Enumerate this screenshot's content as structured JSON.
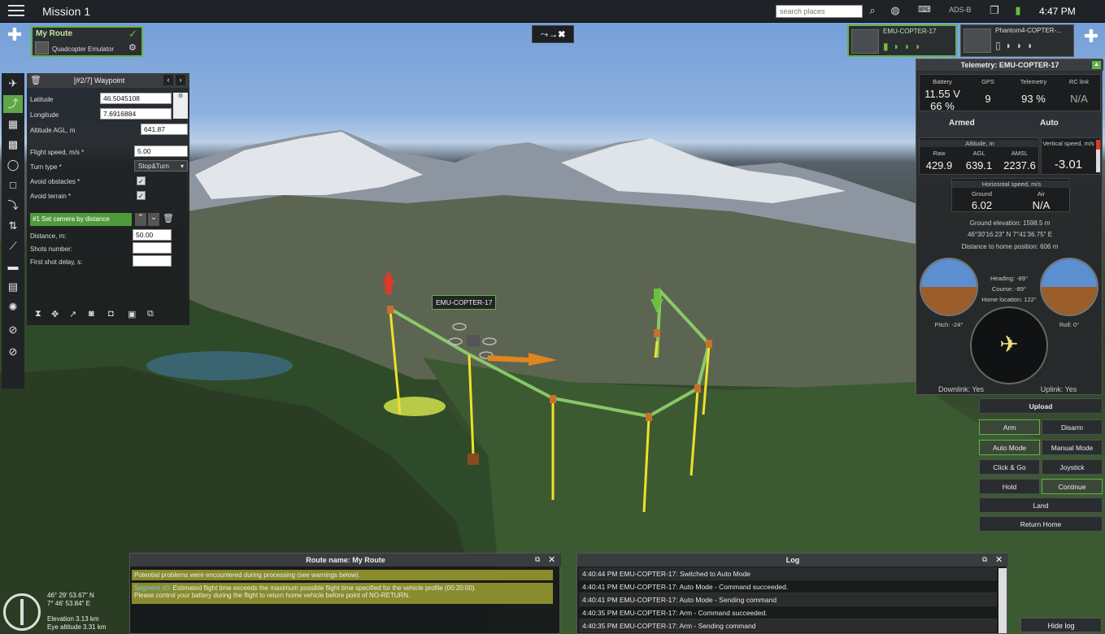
{
  "app": {
    "mission_title": "Mission 1",
    "search_placeholder": "search places",
    "adsb_label": "ADS-B",
    "clock": "4:47 PM"
  },
  "route_card": {
    "name": "My Route",
    "vehicle": "Quadcopter Emulator"
  },
  "vehicles": [
    {
      "name": "EMU-COPTER-17"
    },
    {
      "name": "Phantom4-COPTER-..."
    }
  ],
  "waypoint_panel": {
    "header": "[#2/7] Waypoint",
    "fields": {
      "latitude_label": "Latitude",
      "latitude_value": "46.5045108",
      "longitude_label": "Longitude",
      "longitude_value": "7.6916884",
      "altitude_label": "Altitude AGL, m",
      "altitude_value": "641.87",
      "flight_speed_label": "Flight speed, m/s *",
      "flight_speed_value": "5.00",
      "turn_type_label": "Turn type *",
      "turn_type_value": "Stop&Turn",
      "avoid_obstacles_label": "Avoid obstacles *",
      "avoid_terrain_label": "Avoid terrain *"
    },
    "action": {
      "title": "#1 Set camera by distance",
      "distance_label": "Distance, m:",
      "distance_value": "50.00",
      "shots_label": "Shots number:",
      "first_shot_label": "First shot delay, s:"
    }
  },
  "telemetry": {
    "title": "Telemetry: EMU-COPTER-17",
    "battery_label": "Battery",
    "battery_voltage": "11.55 V",
    "battery_percent": "66 %",
    "gps_label": "GPS",
    "gps_value": "9",
    "telemetry_label": "Telemetry",
    "telemetry_value": "93 %",
    "rc_label": "RC link",
    "rc_value": "N/A",
    "armed": "Armed",
    "mode": "Auto",
    "altitude_header": "Altitude, m",
    "raw_label": "Raw",
    "raw_value": "429.9",
    "agl_label": "AGL",
    "agl_value": "639.1",
    "amsl_label": "AMSL",
    "amsl_value": "2237.6",
    "vspeed_label": "Vertical speed, m/s",
    "vspeed_value": "-3.01",
    "hspeed_header": "Horizontal speed, m/s",
    "ground_label": "Ground",
    "ground_value": "6.02",
    "air_label": "Air",
    "air_value": "N/A",
    "ground_elevation": "Ground elevation: 1598.5 m",
    "coords": "46°30'16.23\" N  7°41'36.75\" E",
    "home_distance": "Distance to home position: 606 m",
    "heading": "Heading: -89°",
    "course": "Course: -89°",
    "home_location": "Home location: 122°",
    "pitch": "Pitch: -24°",
    "roll": "Roll: 0°",
    "downlink": "Downlink: Yes",
    "uplink": "Uplink: Yes"
  },
  "controls": {
    "upload": "Upload",
    "arm": "Arm",
    "disarm": "Disarm",
    "auto_mode": "Auto Mode",
    "manual_mode": "Manual Mode",
    "click_go": "Click & Go",
    "joystick": "Joystick",
    "hold": "Hold",
    "continue": "Continue",
    "land": "Land",
    "return_home": "Return Home"
  },
  "route_panel": {
    "title": "Route name: My Route",
    "warning1": "Potential problems were encountered during processing (see warnings below).",
    "warning2_prefix": "Segment #0:",
    "warning2": " Estimated flight time exceeds the maximum possible flight time specified for the vehicle profile (00:20:00).",
    "warning3": "Please control your battery during the flight to return home vehicle before point of NO-RETURN."
  },
  "log": {
    "title": "Log",
    "entries": [
      "4:40:44 PM  EMU-COPTER-17: Switched to Auto Mode",
      "4:40:41 PM  EMU-COPTER-17: Auto Mode - Command succeeded.",
      "4:40:41 PM  EMU-COPTER-17: Auto Mode - Sending command",
      "4:40:35 PM  EMU-COPTER-17: Arm - Command succeeded.",
      "4:40:35 PM  EMU-COPTER-17: Arm - Sending command"
    ],
    "hide_label": "Hide log"
  },
  "status": {
    "lat": "46° 29' 53.67\" N",
    "lon": "7° 46' 53.84\" E",
    "elevation": "Elevation 3.13 km",
    "eye_altitude": "Eye altitude 3.31 km"
  },
  "map": {
    "drone_label": "EMU-COPTER-17"
  }
}
